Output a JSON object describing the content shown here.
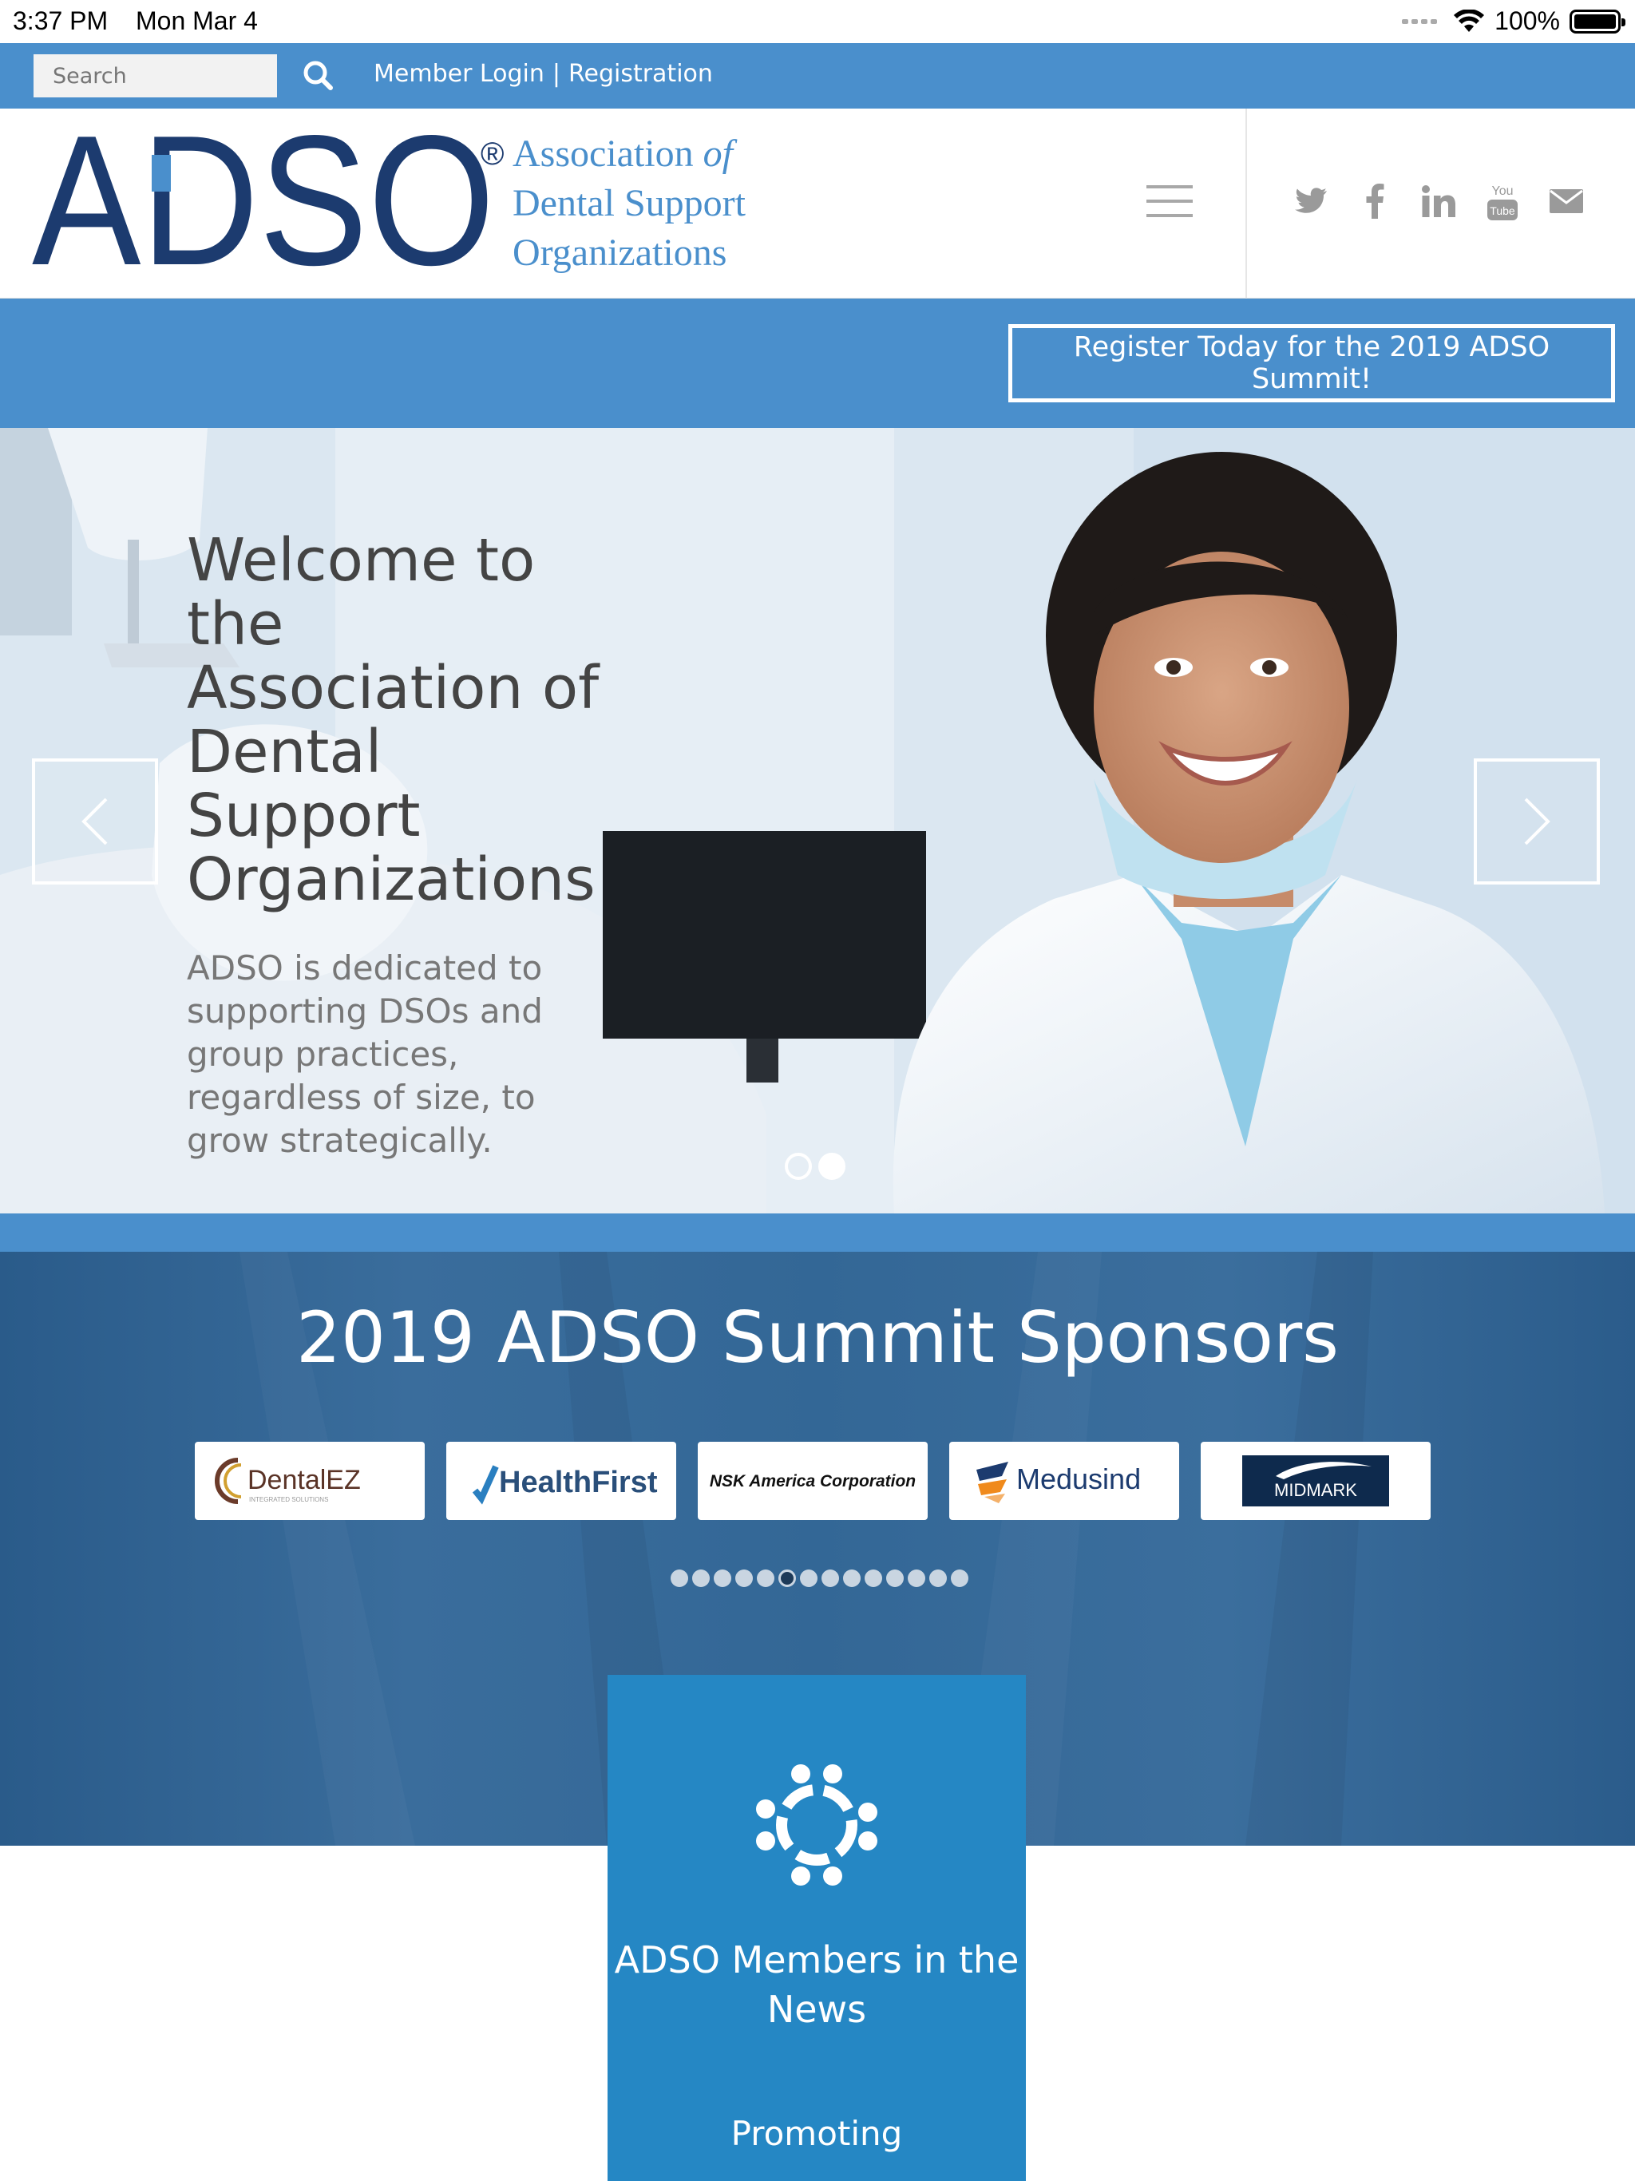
{
  "status_bar": {
    "time": "3:37 PM",
    "date": "Mon Mar 4",
    "battery": "100%"
  },
  "top_bar": {
    "search_placeholder": "Search",
    "member_login": "Member Login",
    "separator": "|",
    "registration": "Registration"
  },
  "header": {
    "logo_mark": "ADSO",
    "registered": "®",
    "org_line1": "Association",
    "org_line1_of": "of",
    "org_line2": "Dental Support",
    "org_line3": "Organizations",
    "social_icons": [
      "twitter-icon",
      "facebook-icon",
      "linkedin-icon",
      "youtube-icon",
      "mail-icon"
    ],
    "youtube_label_top": "You",
    "youtube_label_bottom": "Tube"
  },
  "register_band": {
    "button_label": "Register Today for the 2019 ADSO Summit!"
  },
  "hero": {
    "title": "Welcome to the Association of Dental Support Organizations",
    "subtitle": "ADSO is dedicated to supporting DSOs and group practices, regardless of size, to grow strategically.",
    "slide_count": 2,
    "active_slide": 2
  },
  "sponsors": {
    "title": "2019 ADSO Summit Sponsors",
    "logos": [
      "DentalEZ",
      "HealthFirst",
      "NSK America Corporation",
      "Medusind",
      "MIDMARK"
    ],
    "dentalez_tagline": "INTEGRATED SOLUTIONS",
    "dot_count": 14,
    "active_dot": 6
  },
  "news_card": {
    "title": "ADSO Members in the News",
    "text": "Promoting"
  },
  "colors": {
    "brand_blue": "#4a8fcc",
    "logo_navy": "#1c3b6f",
    "sponsor_bg": "#336796",
    "news_card": "#2587c4"
  }
}
